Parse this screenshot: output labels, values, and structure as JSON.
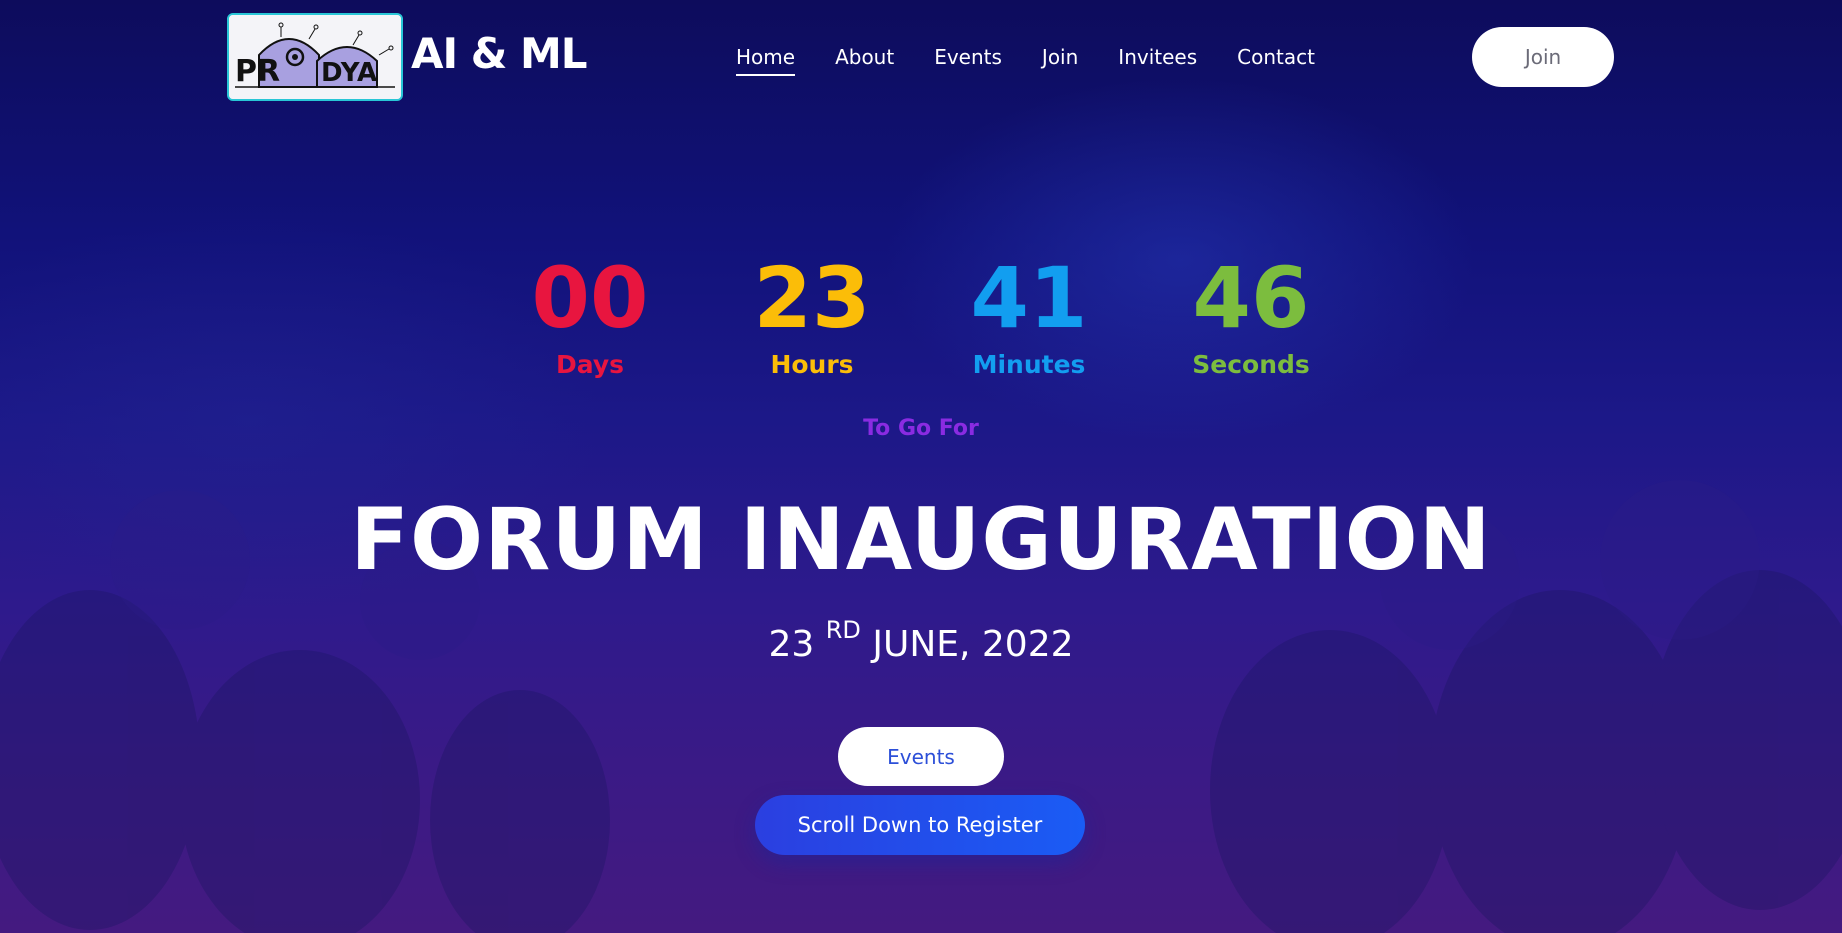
{
  "header": {
    "logo": {
      "icon": "pradnya-logo",
      "text": "PRADNYA"
    },
    "brand": "AI & ML",
    "nav": [
      {
        "label": "Home",
        "active": true
      },
      {
        "label": "About",
        "active": false
      },
      {
        "label": "Events",
        "active": false
      },
      {
        "label": "Join",
        "active": false
      },
      {
        "label": "Invitees",
        "active": false
      },
      {
        "label": "Contact",
        "active": false
      }
    ],
    "join_button": "Join"
  },
  "countdown": {
    "days": {
      "value": "00",
      "label": "Days",
      "color": "#e8153f"
    },
    "hours": {
      "value": "23",
      "label": "Hours",
      "color": "#fbbd08"
    },
    "minutes": {
      "value": "41",
      "label": "Minutes",
      "color": "#129ef0"
    },
    "seconds": {
      "value": "46",
      "label": "Seconds",
      "color": "#7cbd3e"
    }
  },
  "hero": {
    "subtitle": "To Go For",
    "title": "FORUM INAUGURATION",
    "date": {
      "day": "23",
      "suffix": "RD",
      "rest": "JUNE, 2022"
    },
    "events_button": "Events",
    "register_button": "Scroll Down to Register"
  },
  "colors": {
    "accent_purple": "#8a2be2",
    "button_blue": "#2c4fd8",
    "logo_border": "#29c6d6"
  }
}
